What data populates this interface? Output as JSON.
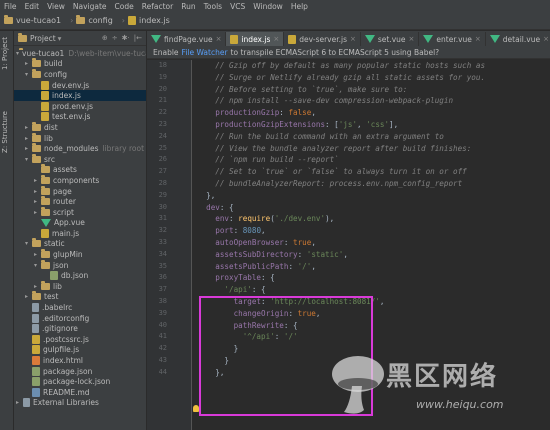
{
  "menu": [
    "File",
    "Edit",
    "View",
    "Navigate",
    "Code",
    "Refactor",
    "Run",
    "Tools",
    "VCS",
    "Window",
    "Help"
  ],
  "breadcrumb": [
    "vue-tucao1",
    "config",
    "index.js"
  ],
  "project_panel": {
    "title": "Project",
    "tools": [
      "⊕",
      "÷",
      "✱·",
      "|←"
    ],
    "side_tabs": [
      "1: Project",
      "Z: Structure"
    ],
    "tree": [
      {
        "label": "vue-tucao1",
        "extra": "D:\\web-item\\vue-tucao1",
        "type": "folder",
        "indent": 0,
        "arrow": "▾"
      },
      {
        "label": "build",
        "type": "folder",
        "indent": 1,
        "arrow": "▸"
      },
      {
        "label": "config",
        "type": "folder",
        "indent": 1,
        "arrow": "▾"
      },
      {
        "label": "dev.env.js",
        "type": "js",
        "indent": 2,
        "arrow": ""
      },
      {
        "label": "index.js",
        "type": "js",
        "indent": 2,
        "arrow": "",
        "selected": true
      },
      {
        "label": "prod.env.js",
        "type": "js",
        "indent": 2,
        "arrow": ""
      },
      {
        "label": "test.env.js",
        "type": "js",
        "indent": 2,
        "arrow": ""
      },
      {
        "label": "dist",
        "type": "folder",
        "indent": 1,
        "arrow": "▸"
      },
      {
        "label": "lib",
        "type": "folder",
        "indent": 1,
        "arrow": "▸"
      },
      {
        "label": "node_modules",
        "extra": "library root",
        "type": "folder",
        "indent": 1,
        "arrow": "▸"
      },
      {
        "label": "src",
        "type": "folder",
        "indent": 1,
        "arrow": "▾"
      },
      {
        "label": "assets",
        "type": "folder",
        "indent": 2,
        "arrow": ""
      },
      {
        "label": "components",
        "type": "folder",
        "indent": 2,
        "arrow": "▸"
      },
      {
        "label": "page",
        "type": "folder",
        "indent": 2,
        "arrow": "▸"
      },
      {
        "label": "router",
        "type": "folder",
        "indent": 2,
        "arrow": "▸"
      },
      {
        "label": "script",
        "type": "folder",
        "indent": 2,
        "arrow": "▸"
      },
      {
        "label": "App.vue",
        "type": "vue",
        "indent": 2,
        "arrow": ""
      },
      {
        "label": "main.js",
        "type": "js",
        "indent": 2,
        "arrow": ""
      },
      {
        "label": "static",
        "type": "folder",
        "indent": 1,
        "arrow": "▾"
      },
      {
        "label": "glupMin",
        "type": "folder",
        "indent": 2,
        "arrow": "▸"
      },
      {
        "label": "json",
        "type": "folder",
        "indent": 2,
        "arrow": "▾"
      },
      {
        "label": "db.json",
        "type": "json",
        "indent": 3,
        "arrow": ""
      },
      {
        "label": "lib",
        "type": "folder",
        "indent": 2,
        "arrow": "▸"
      },
      {
        "label": "test",
        "type": "folder",
        "indent": 1,
        "arrow": "▸"
      },
      {
        "label": ".babelrc",
        "type": "file",
        "indent": 1,
        "arrow": ""
      },
      {
        "label": ".editorconfig",
        "type": "file",
        "indent": 1,
        "arrow": ""
      },
      {
        "label": ".gitignore",
        "type": "file",
        "indent": 1,
        "arrow": ""
      },
      {
        "label": ".postcssrc.js",
        "type": "js",
        "indent": 1,
        "arrow": ""
      },
      {
        "label": "gulpfile.js",
        "type": "js",
        "indent": 1,
        "arrow": ""
      },
      {
        "label": "index.html",
        "type": "html",
        "indent": 1,
        "arrow": ""
      },
      {
        "label": "package.json",
        "type": "json",
        "indent": 1,
        "arrow": ""
      },
      {
        "label": "package-lock.json",
        "type": "json",
        "indent": 1,
        "arrow": ""
      },
      {
        "label": "README.md",
        "type": "md",
        "indent": 1,
        "arrow": ""
      },
      {
        "label": "External Libraries",
        "type": "lib",
        "indent": 0,
        "arrow": "▸"
      }
    ]
  },
  "tabs": [
    {
      "label": "findPage.vue",
      "type": "vue",
      "active": false
    },
    {
      "label": "index.js",
      "type": "js",
      "active": true
    },
    {
      "label": "dev-server.js",
      "type": "js",
      "active": false
    },
    {
      "label": "set.vue",
      "type": "vue",
      "active": false
    },
    {
      "label": "enter.vue",
      "type": "vue",
      "active": false
    },
    {
      "label": "detail.vue",
      "type": "vue",
      "active": false
    }
  ],
  "banner": {
    "pre": "Enable",
    "link": "File Watcher",
    "post": "to transpile ECMAScript 6 to ECMAScript 5 using Babel?"
  },
  "code_lines": [
    {
      "n": "18",
      "segs": [
        [
          "c-com",
          "    // Gzip off by default as many popular static hosts such as"
        ]
      ]
    },
    {
      "n": "19",
      "segs": [
        [
          "c-com",
          "    // Surge or Netlify already gzip all static assets for you."
        ]
      ]
    },
    {
      "n": "20",
      "segs": [
        [
          "c-com",
          "    // Before setting to `true`, make sure to:"
        ]
      ]
    },
    {
      "n": "21",
      "segs": [
        [
          "c-com",
          "    // npm install --save-dev compression-webpack-plugin"
        ]
      ]
    },
    {
      "n": "22",
      "segs": [
        [
          "c-prop",
          "    productionGzip"
        ],
        [
          "c-plain",
          ": "
        ],
        [
          "c-kw",
          "false"
        ],
        [
          "c-plain",
          ","
        ]
      ]
    },
    {
      "n": "23",
      "segs": [
        [
          "c-prop",
          "    productionGzipExtensions"
        ],
        [
          "c-plain",
          ": ["
        ],
        [
          "c-str",
          "'js'"
        ],
        [
          "c-plain",
          ", "
        ],
        [
          "c-str",
          "'css'"
        ],
        [
          "c-plain",
          "],"
        ]
      ]
    },
    {
      "n": "24",
      "segs": [
        [
          "c-com",
          "    // Run the build command with an extra argument to"
        ]
      ]
    },
    {
      "n": "25",
      "segs": [
        [
          "c-com",
          "    // View the bundle analyzer report after build finishes:"
        ]
      ]
    },
    {
      "n": "26",
      "segs": [
        [
          "c-com",
          "    // `npm run build --report`"
        ]
      ]
    },
    {
      "n": "27",
      "segs": [
        [
          "c-com",
          "    // Set to `true` or `false` to always turn it on or off"
        ]
      ]
    },
    {
      "n": "28",
      "segs": [
        [
          "c-com",
          "    // bundleAnalyzerReport: process.env.npm_config_report"
        ]
      ]
    },
    {
      "n": "29",
      "segs": [
        [
          "c-plain",
          "  },"
        ]
      ]
    },
    {
      "n": "30",
      "segs": [
        [
          "c-prop",
          "  dev"
        ],
        [
          "c-plain",
          ": {"
        ]
      ]
    },
    {
      "n": "31",
      "segs": [
        [
          "c-prop",
          "    env"
        ],
        [
          "c-plain",
          ": "
        ],
        [
          "c-fn",
          "require"
        ],
        [
          "c-plain",
          "("
        ],
        [
          "c-str",
          "'./dev.env'"
        ],
        [
          "c-plain",
          "),"
        ]
      ]
    },
    {
      "n": "32",
      "segs": [
        [
          "c-prop",
          "    port"
        ],
        [
          "c-plain",
          ": "
        ],
        [
          "c-num",
          "8080"
        ],
        [
          "c-plain",
          ","
        ]
      ]
    },
    {
      "n": "33",
      "segs": [
        [
          "c-prop",
          "    autoOpenBrowser"
        ],
        [
          "c-plain",
          ": "
        ],
        [
          "c-kw",
          "true"
        ],
        [
          "c-plain",
          ","
        ]
      ]
    },
    {
      "n": "34",
      "segs": [
        [
          "c-prop",
          "    assetsSubDirectory"
        ],
        [
          "c-plain",
          ": "
        ],
        [
          "c-str",
          "'static'"
        ],
        [
          "c-plain",
          ","
        ]
      ]
    },
    {
      "n": "35",
      "segs": [
        [
          "c-prop",
          "    assetsPublicPath"
        ],
        [
          "c-plain",
          ": "
        ],
        [
          "c-str",
          "'/'"
        ],
        [
          "c-plain",
          ","
        ]
      ]
    },
    {
      "n": "36",
      "segs": [
        [
          "c-prop",
          "    proxyTable"
        ],
        [
          "c-plain",
          ": {"
        ]
      ]
    },
    {
      "n": "37",
      "segs": [
        [
          "c-str",
          "      '/api'"
        ],
        [
          "c-plain",
          ": {"
        ]
      ]
    },
    {
      "n": "38",
      "segs": [
        [
          "c-prop",
          "        target"
        ],
        [
          "c-plain",
          ": "
        ],
        [
          "c-str",
          "'http://localhost:8081/'"
        ],
        [
          "c-plain",
          ","
        ]
      ]
    },
    {
      "n": "39",
      "segs": [
        [
          "c-prop",
          "        changeOrigin"
        ],
        [
          "c-plain",
          ": "
        ],
        [
          "c-kw",
          "true"
        ],
        [
          "c-plain",
          ","
        ]
      ]
    },
    {
      "n": "40",
      "segs": [
        [
          "c-prop",
          "        pathRewrite"
        ],
        [
          "c-plain",
          ": {"
        ]
      ]
    },
    {
      "n": "41",
      "segs": [
        [
          "c-str",
          "          '^/api'"
        ],
        [
          "c-plain",
          ": "
        ],
        [
          "c-str",
          "'/'"
        ]
      ]
    },
    {
      "n": "42",
      "segs": [
        [
          "c-plain",
          "        }"
        ]
      ]
    },
    {
      "n": "43",
      "segs": [
        [
          "c-plain",
          "      }"
        ]
      ]
    },
    {
      "n": "44",
      "segs": [
        [
          "c-plain",
          "    },"
        ]
      ]
    }
  ],
  "watermark": {
    "text": "黑区网络",
    "url": "www.heiqu.com"
  },
  "colors": {
    "highlight": "#d93ad9",
    "background": "#2b2b2b",
    "panel": "#3c3f41"
  }
}
